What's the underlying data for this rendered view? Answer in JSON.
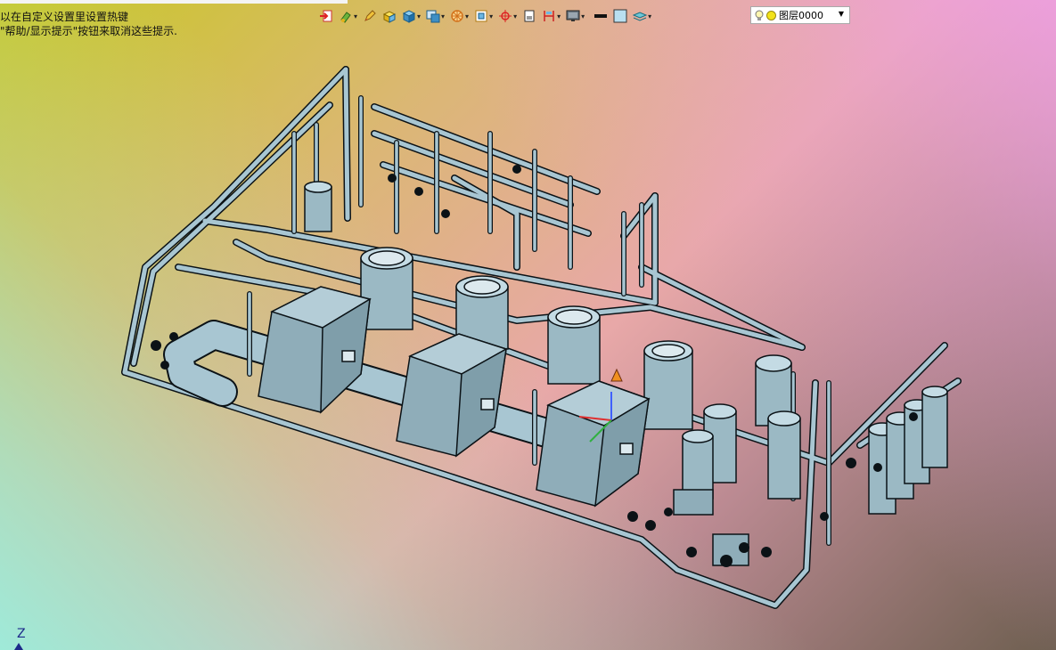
{
  "hints": {
    "line1": "以在自定义设置里设置热键",
    "line2": "\"帮助/显示提示\"按钮来取消这些提示."
  },
  "toolbar": {
    "buttons": [
      {
        "icon": "insert-icon",
        "dropdown": false
      },
      {
        "icon": "paint-icon",
        "dropdown": true
      },
      {
        "icon": "pencil-icon",
        "dropdown": false
      },
      {
        "icon": "box-yellow-icon",
        "dropdown": false
      },
      {
        "icon": "cube-icon",
        "dropdown": true
      },
      {
        "icon": "component-icon",
        "dropdown": true
      },
      {
        "icon": "wheel-icon",
        "dropdown": true
      },
      {
        "icon": "frame-icon",
        "dropdown": true
      },
      {
        "icon": "crosshair-icon",
        "dropdown": true
      },
      {
        "icon": "page-icon",
        "dropdown": false
      },
      {
        "icon": "dimension-icon",
        "dropdown": true
      },
      {
        "icon": "monitor-icon",
        "dropdown": true
      },
      {
        "icon": "line-weight-icon",
        "dropdown": false
      },
      {
        "icon": "fill-color-icon",
        "dropdown": false
      },
      {
        "icon": "layers-icon",
        "dropdown": true
      }
    ],
    "layer": {
      "name": "图层0000"
    }
  },
  "axis": {
    "label": "Z"
  },
  "colors": {
    "pipe": "#a8c6d2",
    "edge": "#0b1216",
    "body": "#9bb9c4"
  }
}
